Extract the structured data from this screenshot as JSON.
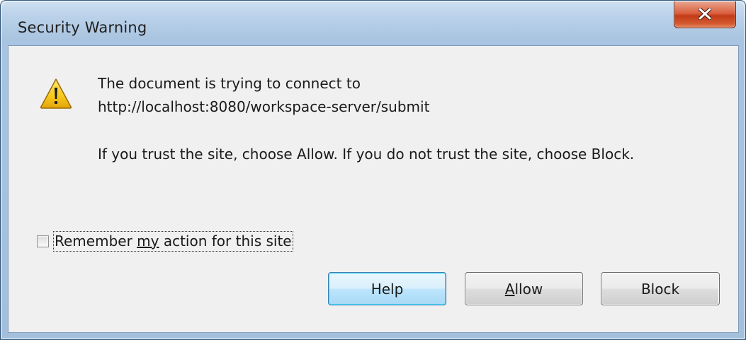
{
  "window": {
    "title": "Security Warning"
  },
  "message": {
    "line1": "The document is trying to connect to",
    "line2": "http://localhost:8080/workspace-server/submit",
    "line3": "If you trust the site, choose Allow. If you do not trust the site, choose Block."
  },
  "remember": {
    "label_before": "Remember ",
    "label_mnemonic": "my",
    "label_after": " action for this site",
    "checked": false
  },
  "buttons": {
    "help": "Help",
    "allow_mnemonic": "A",
    "allow_rest": "llow",
    "block": "Block"
  },
  "icons": {
    "warning": "warning-triangle-icon",
    "close": "close-x-icon"
  },
  "colors": {
    "close_button": "#c23b17",
    "titlebar": "#bcd3ea",
    "client_background": "#f0f0f0",
    "default_button_border": "#3c7fb1",
    "warning_yellow": "#f6c81b"
  }
}
